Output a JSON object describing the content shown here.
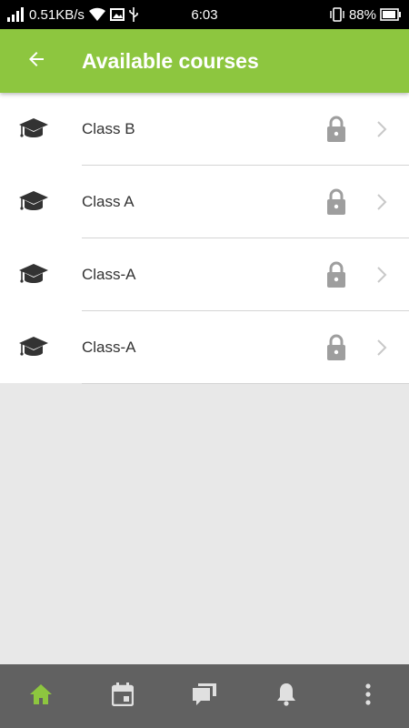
{
  "status_bar": {
    "network_speed": "0.51KB/s",
    "time": "6:03",
    "battery": "88%"
  },
  "app_bar": {
    "title": "Available courses",
    "back_icon": "arrow-left-icon"
  },
  "courses": [
    {
      "label": "Class B",
      "icon": "graduation-cap-icon",
      "locked": true
    },
    {
      "label": "Class A",
      "icon": "graduation-cap-icon",
      "locked": true
    },
    {
      "label": "Class-A",
      "icon": "graduation-cap-icon",
      "locked": true
    },
    {
      "label": "Class-A",
      "icon": "graduation-cap-icon",
      "locked": true
    }
  ],
  "bottom_nav": [
    {
      "icon": "home-icon",
      "active": true
    },
    {
      "icon": "calendar-icon",
      "active": false
    },
    {
      "icon": "messages-icon",
      "active": false
    },
    {
      "icon": "bell-icon",
      "active": false
    },
    {
      "icon": "more-vert-icon",
      "active": false
    }
  ],
  "colors": {
    "accent": "#8dc63f",
    "bottom_nav_bg": "#616161",
    "icon_inactive": "#e0e0e0",
    "lock": "#9e9e9e"
  }
}
